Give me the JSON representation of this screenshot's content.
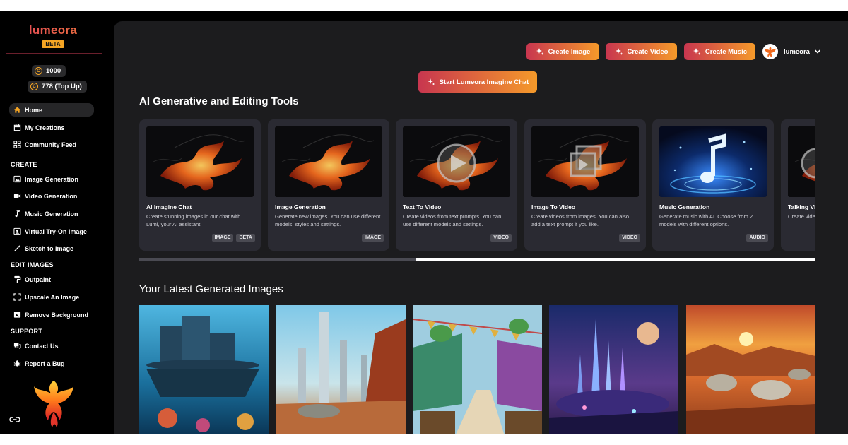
{
  "brand": {
    "name": "lumeora",
    "badge": "BETA"
  },
  "credits": {
    "balance": "1000",
    "topup": "778 (Top Up)",
    "coin_icon": "coin-icon"
  },
  "nav": {
    "main": [
      {
        "label": "Home",
        "icon": "home-icon",
        "active": true
      },
      {
        "label": "My Creations",
        "icon": "calendar-icon"
      },
      {
        "label": "Community Feed",
        "icon": "grid-icon"
      }
    ],
    "create_title": "CREATE",
    "create": [
      {
        "label": "Image Generation",
        "icon": "image-icon"
      },
      {
        "label": "Video Generation",
        "icon": "video-icon"
      },
      {
        "label": "Music Generation",
        "icon": "music-note-icon"
      },
      {
        "label": "Virtual Try-On Image",
        "icon": "try-on-icon"
      },
      {
        "label": "Sketch to Image",
        "icon": "wand-icon"
      }
    ],
    "edit_title": "EDIT IMAGES",
    "edit": [
      {
        "label": "Outpaint",
        "icon": "paint-roller-icon"
      },
      {
        "label": "Upscale An Image",
        "icon": "expand-icon"
      },
      {
        "label": "Remove Background",
        "icon": "remove-bg-icon"
      }
    ],
    "support_title": "SUPPORT",
    "support": [
      {
        "label": "Contact Us",
        "icon": "chat-icon"
      },
      {
        "label": "Report a Bug",
        "icon": "bug-icon"
      }
    ]
  },
  "header": {
    "buttons": [
      "Create Image",
      "Create Video",
      "Create Music"
    ],
    "username": "lumeora"
  },
  "chat_button": "Start Lumeora Imagine Chat",
  "tools": {
    "title": "AI Generative and Editing Tools",
    "cards": [
      {
        "title": "AI Imagine Chat",
        "desc": "Create stunning images in our chat with Lumi, your AI assistant.",
        "tags": [
          "IMAGE",
          "BETA"
        ],
        "thumb": "phoenix"
      },
      {
        "title": "Image Generation",
        "desc": "Generate new images. You can use different models, styles and settings.",
        "tags": [
          "IMAGE"
        ],
        "thumb": "phoenix"
      },
      {
        "title": "Text To Video",
        "desc": "Create videos from text prompts. You can use different models and settings.",
        "tags": [
          "VIDEO"
        ],
        "thumb": "phoenix-play"
      },
      {
        "title": "Image To Video",
        "desc": "Create videos from images. You can also add a text prompt if you like.",
        "tags": [
          "VIDEO"
        ],
        "thumb": "phoenix-frames"
      },
      {
        "title": "Music Generation",
        "desc": "Generate music with AI. Choose from 2 models with different options.",
        "tags": [
          "AUDIO"
        ],
        "thumb": "music"
      },
      {
        "title": "Talking Vi",
        "desc": "Create videos advanced L",
        "tags": [],
        "thumb": "phoenix-play"
      }
    ],
    "scroll_fraction": 0.41
  },
  "gallery": {
    "title": "Your Latest Generated Images"
  },
  "colors": {
    "accent_start": "#c8364f",
    "accent_end": "#f59a2a",
    "panel": "#1c1c1e",
    "card": "#2a2a32"
  }
}
